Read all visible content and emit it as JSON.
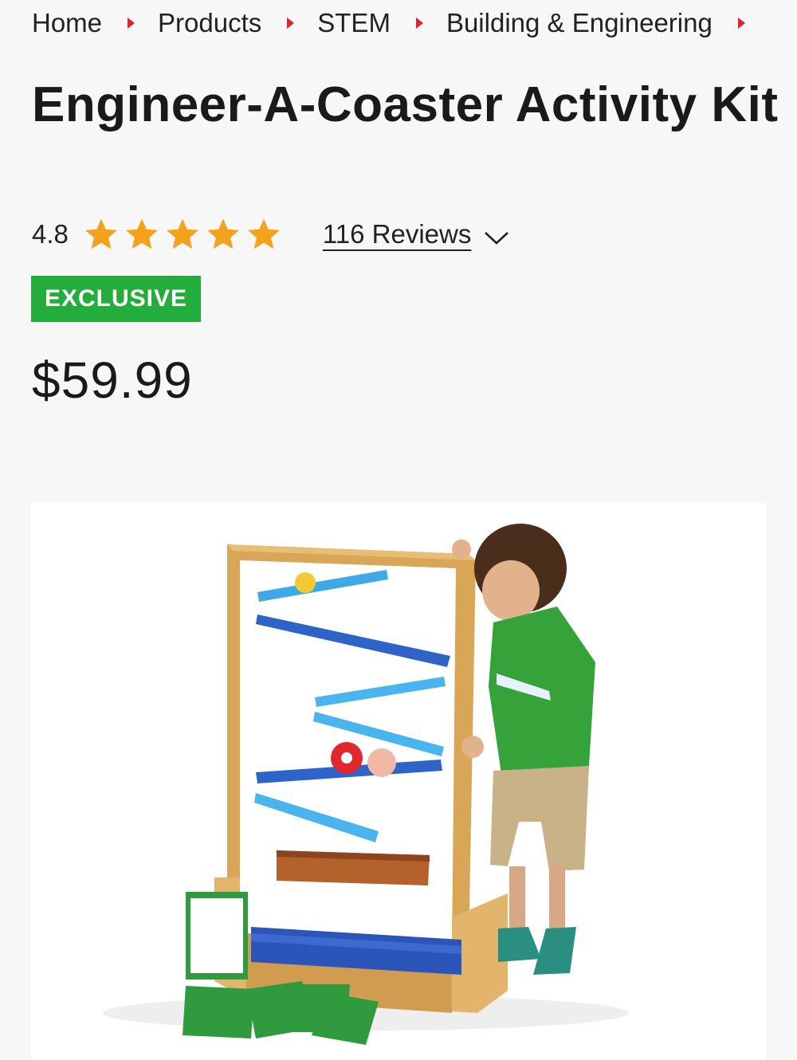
{
  "breadcrumb": {
    "items": [
      "Home",
      "Products",
      "STEM",
      "Building & Engineering"
    ]
  },
  "product": {
    "title": "Engineer-A-Coaster Activity Kit",
    "rating": "4.8",
    "rating_stars": 4.8,
    "reviews_label": "116 Reviews",
    "badge": "EXCLUSIVE",
    "price": "$59.99",
    "image_alt": "Engineer-A-Coaster Activity Kit"
  },
  "colors": {
    "accent_red": "#d9252e",
    "star": "#f4a11b",
    "badge_green": "#24ac3c"
  },
  "icons": {
    "breadcrumb_separator": "caret-right-icon",
    "star": "star-icon",
    "reviews_toggle": "chevron-down-icon"
  }
}
